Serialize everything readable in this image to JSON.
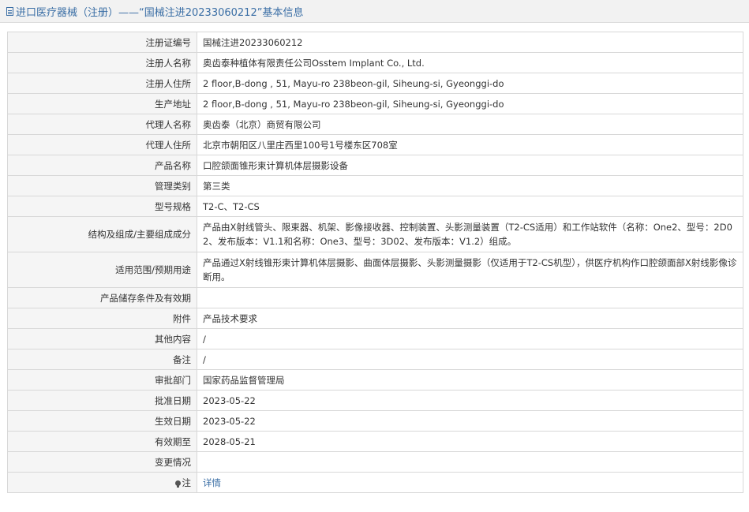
{
  "header": {
    "title": "进口医疗器械（注册）——“国械注进20233060212”基本信息",
    "icon": "document-icon"
  },
  "rows": [
    {
      "label": "注册证编号",
      "value": "国械注进20233060212"
    },
    {
      "label": "注册人名称",
      "value": "奥齿泰种植体有限责任公司Osstem Implant Co., Ltd."
    },
    {
      "label": "注册人住所",
      "value": "2 floor,B-dong , 51, Mayu-ro 238beon-gil, Siheung-si, Gyeonggi-do"
    },
    {
      "label": "生产地址",
      "value": "2 floor,B-dong , 51, Mayu-ro 238beon-gil, Siheung-si, Gyeonggi-do"
    },
    {
      "label": "代理人名称",
      "value": "奥齿泰（北京）商贸有限公司"
    },
    {
      "label": "代理人住所",
      "value": "北京市朝阳区八里庄西里100号1号楼东区708室"
    },
    {
      "label": "产品名称",
      "value": "口腔颌面锥形束计算机体层摄影设备"
    },
    {
      "label": "管理类别",
      "value": "第三类"
    },
    {
      "label": "型号规格",
      "value": "T2-C、T2-CS"
    },
    {
      "label": "结构及组成/主要组成成分",
      "value": "产品由X射线管头、限束器、机架、影像接收器、控制装置、头影测量装置（T2-CS适用）和工作站软件（名称：One2、型号：2D02、发布版本：V1.1和名称：One3、型号：3D02、发布版本：V1.2）组成。"
    },
    {
      "label": "适用范围/预期用途",
      "value": "产品通过X射线锥形束计算机体层摄影、曲面体层摄影、头影测量摄影（仅适用于T2-CS机型），供医疗机构作口腔颌面部X射线影像诊断用。"
    },
    {
      "label": "产品储存条件及有效期",
      "value": ""
    },
    {
      "label": "附件",
      "value": "产品技术要求"
    },
    {
      "label": "其他内容",
      "value": "/"
    },
    {
      "label": "备注",
      "value": "/"
    },
    {
      "label": "审批部门",
      "value": "国家药品监督管理局"
    },
    {
      "label": "批准日期",
      "value": "2023-05-22"
    },
    {
      "label": "生效日期",
      "value": "2023-05-22"
    },
    {
      "label": "有效期至",
      "value": "2028-05-21"
    },
    {
      "label": "变更情况",
      "value": ""
    }
  ],
  "note": {
    "label": "注",
    "link": "详情",
    "icon": "pin-icon"
  }
}
